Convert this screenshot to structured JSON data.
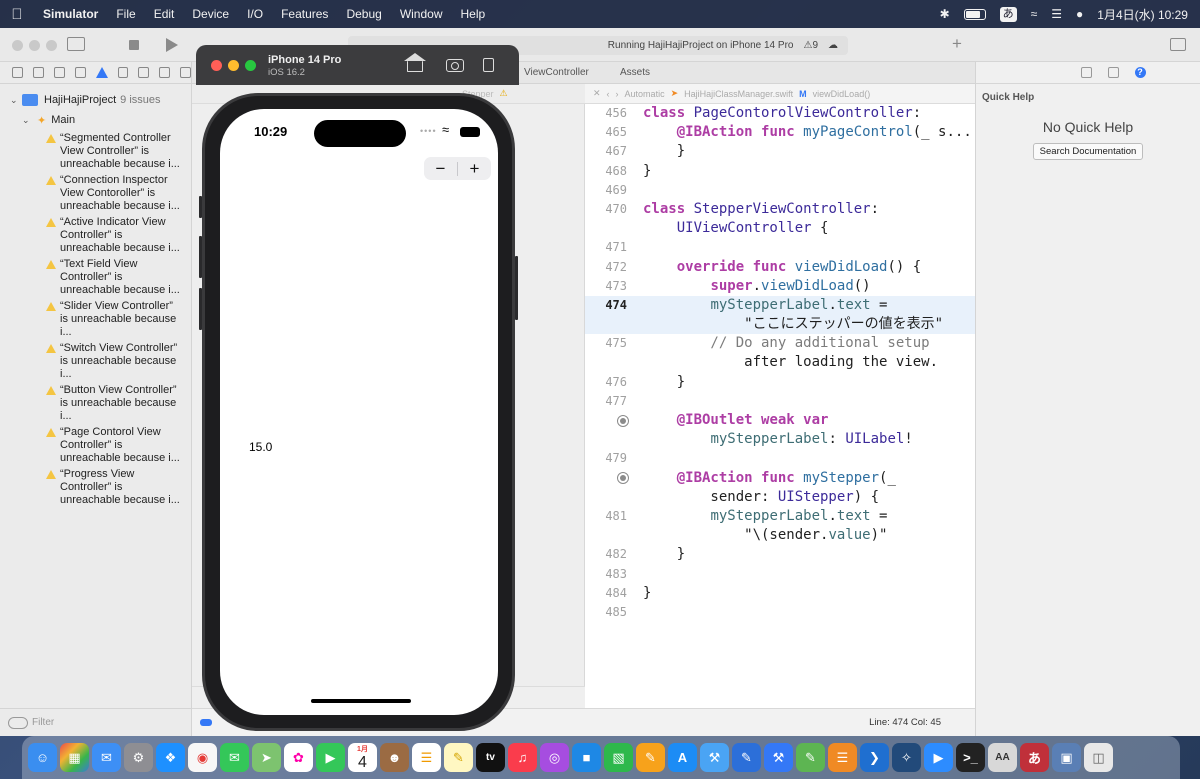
{
  "menubar": {
    "app_name": "Simulator",
    "items": [
      "File",
      "Edit",
      "Device",
      "I/O",
      "Features",
      "Debug",
      "Window",
      "Help"
    ],
    "input_method": "あ",
    "datetime": "1月4日(水)  10:29"
  },
  "xcode": {
    "status_text": "Running HajiHajiProject on iPhone 14 Pro",
    "issue_count": "9",
    "editor_tab_1": "ViewController",
    "editor_tab_2": "Assets",
    "jumpbar": {
      "mode": "Automatic",
      "file": "HajiHajiClassManager.swift",
      "method": "viewDidLoad()"
    },
    "left_jumpbar_text": "Stepper"
  },
  "navigator": {
    "project_name": "HajiHajiProject",
    "project_issues": "9 issues",
    "group_name": "Main",
    "issues": [
      "“Segmented Controller View Controller” is unreachable because i...",
      "“Connection Inspector View Contoroller” is unreachable because i...",
      "“Active Indicator View Controller” is unreachable because i...",
      "“Text Field View Controller” is unreachable because i...",
      "“Slider View Controller” is unreachable because i...",
      "“Switch View Controller” is unreachable because i...",
      "“Button View Controller” is unreachable because i...",
      "“Page Contorol View Controller” is unreachable because i...",
      "“Progress View Controller” is unreachable because i..."
    ],
    "filter_placeholder": "Filter"
  },
  "simulator": {
    "device_name": "iPhone 14 Pro",
    "os_version": "iOS 16.2",
    "status_time": "10:29",
    "stepper_minus": "−",
    "stepper_plus": "+",
    "label_value": "15.0"
  },
  "code": {
    "lines": [
      {
        "num": "456",
        "text": "class PageContorolViewController:"
      },
      {
        "num": "465",
        "text": "    @IBAction func myPageControl(_ s..."
      },
      {
        "num": "467",
        "text": "    }"
      },
      {
        "num": "468",
        "text": "}"
      },
      {
        "num": "469",
        "text": ""
      },
      {
        "num": "470",
        "text": "class StepperViewController:"
      },
      {
        "num": "",
        "text": "    UIViewController {"
      },
      {
        "num": "471",
        "text": ""
      },
      {
        "num": "472",
        "text": "    override func viewDidLoad() {"
      },
      {
        "num": "473",
        "text": "        super.viewDidLoad()"
      },
      {
        "num": "474",
        "text": "        myStepperLabel.text ="
      },
      {
        "num": "",
        "text": "            \"ここにステッパーの値を表示\""
      },
      {
        "num": "475",
        "text": "        // Do any additional setup"
      },
      {
        "num": "",
        "text": "            after loading the view."
      },
      {
        "num": "476",
        "text": "    }"
      },
      {
        "num": "477",
        "text": ""
      },
      {
        "num": "",
        "text": "    @IBOutlet weak var"
      },
      {
        "num": "",
        "text": "        myStepperLabel: UILabel!"
      },
      {
        "num": "479",
        "text": ""
      },
      {
        "num": "",
        "text": "    @IBAction func myStepper(_"
      },
      {
        "num": "",
        "text": "        sender: UIStepper) {"
      },
      {
        "num": "481",
        "text": "        myStepperLabel.text ="
      },
      {
        "num": "",
        "text": "            \"\\(sender.value)\""
      },
      {
        "num": "482",
        "text": "    }"
      },
      {
        "num": "483",
        "text": ""
      },
      {
        "num": "484",
        "text": "}"
      },
      {
        "num": "485",
        "text": ""
      }
    ]
  },
  "status_bar": {
    "position": "Line: 474  Col: 45"
  },
  "inspector": {
    "title": "Quick Help",
    "empty_text": "No Quick Help",
    "search_button": "Search Documentation"
  },
  "dock": {
    "calendar_day": "4",
    "calendar_month": "1月",
    "tv_label": "tv"
  },
  "colors": {
    "keyword": "#ad3da4",
    "type": "#3c2a99",
    "function": "#2f6fa0",
    "highlight_line": "#e8f1fb",
    "warning": "#f4c542",
    "accent": "#3478f6"
  }
}
